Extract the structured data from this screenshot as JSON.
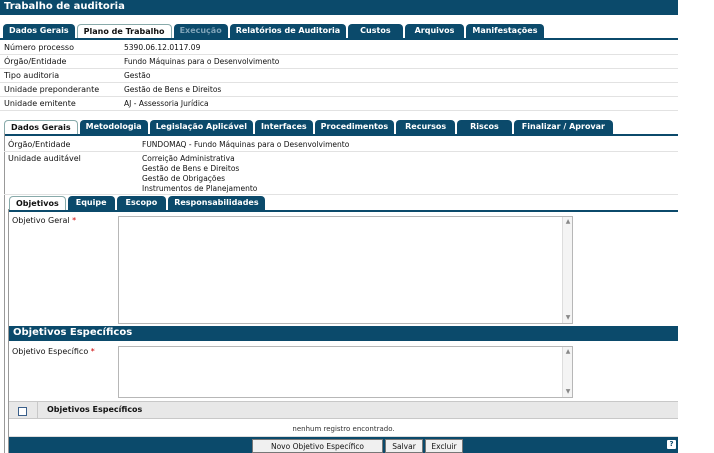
{
  "title": "Trabalho de auditoria",
  "main_tabs": [
    {
      "label": "Dados Gerais"
    },
    {
      "label": "Plano de Trabalho"
    },
    {
      "label": "Execução"
    },
    {
      "label": "Relatórios de Auditoria"
    },
    {
      "label": "Custos"
    },
    {
      "label": "Arquivos"
    },
    {
      "label": "Manifestações"
    }
  ],
  "info": [
    {
      "label": "Número processo",
      "value": "5390.06.12.0117.09"
    },
    {
      "label": "Órgão/Entidade",
      "value": "Fundo Máquinas para o Desenvolvimento"
    },
    {
      "label": "Tipo auditoria",
      "value": "Gestão"
    },
    {
      "label": "Unidade preponderante",
      "value": "Gestão de Bens e Direitos"
    },
    {
      "label": "Unidade emitente",
      "value": "AJ - Assessoria Jurídica"
    }
  ],
  "plan_tabs": [
    {
      "label": "Dados Gerais"
    },
    {
      "label": "Metodologia"
    },
    {
      "label": "Legislação Aplicável"
    },
    {
      "label": "Interfaces"
    },
    {
      "label": "Procedimentos"
    },
    {
      "label": "Recursos"
    },
    {
      "label": "Riscos"
    },
    {
      "label": "Finalizar / Aprovar"
    }
  ],
  "plan_info": {
    "orgao_label": "Órgão/Entidade",
    "orgao_value": "FUNDOMAQ - Fundo Máquinas para o Desenvolvimento",
    "unidade_label": "Unidade auditável",
    "unidades": [
      "Correição Administrativa",
      "Gestão de Bens e Direitos",
      "Gestão de Obrigações",
      "Instrumentos de Planejamento"
    ]
  },
  "sub_tabs": [
    {
      "label": "Objetivos"
    },
    {
      "label": "Equipe"
    },
    {
      "label": "Escopo"
    },
    {
      "label": "Responsabilidades"
    }
  ],
  "objetivo_geral": {
    "label": "Objetivo Geral",
    "required": "*",
    "value": ""
  },
  "especificos": {
    "section_title": "Objetivos Específicos",
    "field_label": "Objetivo Específico",
    "required": "*",
    "value": "",
    "column_header": "Objetivos Específicos",
    "empty_message": "nenhum registro encontrado."
  },
  "buttons": {
    "novo": "Novo Objetivo Específico",
    "salvar": "Salvar",
    "excluir": "Excluir",
    "help": "?"
  },
  "colors": {
    "header_blue": "#0b4a6b"
  },
  "icons": {
    "scroll_up": "▲",
    "scroll_down": "▼",
    "help": "help-icon"
  }
}
